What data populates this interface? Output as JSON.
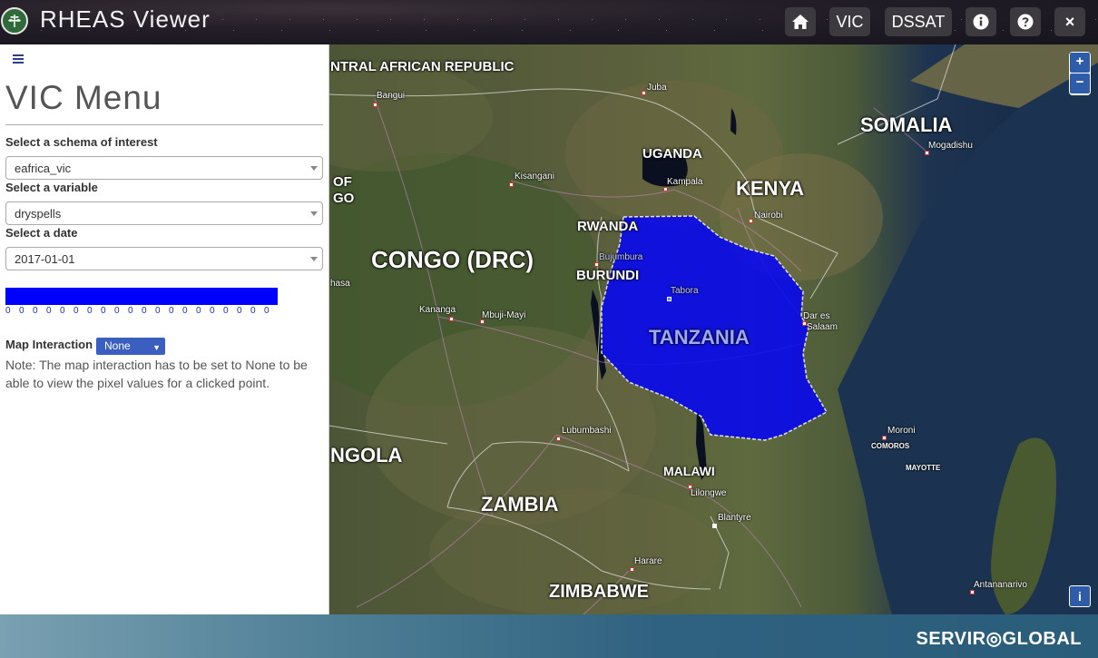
{
  "header": {
    "title": "RHEAS Viewer",
    "buttons": {
      "home_icon": "home-icon",
      "vic": "VIC",
      "dssat": "DSSAT",
      "info_icon": "info-icon",
      "help_icon": "question-icon",
      "close": "×"
    }
  },
  "sidebar": {
    "title": "VIC Menu",
    "schema_label": "Select a schema of interest",
    "schema_value": "eafrica_vic",
    "variable_label": "Select a variable",
    "variable_value": "dryspells",
    "date_label": "Select a date",
    "date_value": "2017-01-01",
    "legend_color": "#0000ff",
    "legend_ticks": [
      "0",
      "0",
      "0",
      "0",
      "0",
      "0",
      "0",
      "0",
      "0",
      "0",
      "0",
      "0",
      "0",
      "0",
      "0",
      "0",
      "0",
      "0",
      "0",
      "0"
    ],
    "map_interaction_label": "Map Interaction",
    "map_interaction_value": "None",
    "note": "Note: The map interaction has to be set to None to be able to view the pixel values for a clicked point."
  },
  "map": {
    "countries": [
      "NTRAL AFRICAN REPUBLIC",
      "SOMALIA",
      "UGANDA",
      "KENYA",
      "RWANDA",
      "BURUNDI",
      "CONGO (DRC)",
      "TANZANIA",
      "NGOLA",
      "ZAMBIA",
      "MALAWI",
      "ZIMBABWE",
      "OF",
      "GO"
    ],
    "cities": [
      "Bangui",
      "Juba",
      "Mogadishu",
      "Kisangani",
      "Kampala",
      "Nairobi",
      "Bujumbura",
      "Tabora",
      "Dar es",
      "Salaam",
      "Kananga",
      "Mbuji-Mayi",
      "Lubumbashi",
      "Lilongwe",
      "Blantyre",
      "Moroni",
      "COMOROS",
      "MAYOTTE",
      "Harare",
      "Antananarivo",
      "hasa"
    ],
    "highlight_color": "#0000ff",
    "zoom_in": "+",
    "zoom_out": "−",
    "info": "i"
  },
  "footer": {
    "brand": "SERVIR◎GLOBAL"
  }
}
